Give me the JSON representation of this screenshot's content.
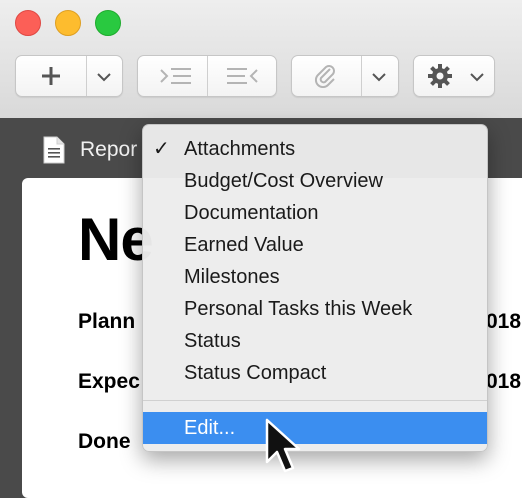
{
  "window": {
    "traffic_lights": [
      "close",
      "minimize",
      "zoom"
    ]
  },
  "toolbar": {
    "buttons": [
      {
        "name": "add",
        "icon": "plus-icon"
      },
      {
        "name": "add-menu",
        "icon": "chevron-down-icon"
      },
      {
        "name": "indent",
        "icon": "indent-icon"
      },
      {
        "name": "outdent",
        "icon": "outdent-icon"
      },
      {
        "name": "attach",
        "icon": "paperclip-icon"
      },
      {
        "name": "attach-menu",
        "icon": "chevron-down-icon"
      },
      {
        "name": "settings",
        "icon": "gear-icon"
      }
    ]
  },
  "document": {
    "header_label": "Repor",
    "title": "Ne",
    "fields": [
      {
        "label": "Plann",
        "value": "018"
      },
      {
        "label": "Expec",
        "value": "018"
      },
      {
        "label": "Done",
        "value": ""
      }
    ]
  },
  "menu": {
    "items": [
      {
        "label": "Attachments",
        "checked": true
      },
      {
        "label": "Budget/Cost Overview",
        "checked": false
      },
      {
        "label": "Documentation",
        "checked": false
      },
      {
        "label": "Earned Value",
        "checked": false
      },
      {
        "label": "Milestones",
        "checked": false
      },
      {
        "label": "Personal Tasks this Week",
        "checked": false
      },
      {
        "label": "Status",
        "checked": false
      },
      {
        "label": "Status Compact",
        "checked": false
      }
    ],
    "check_glyph": "✓",
    "edit_label": "Edit...",
    "highlight_color": "#3b8ef0"
  }
}
